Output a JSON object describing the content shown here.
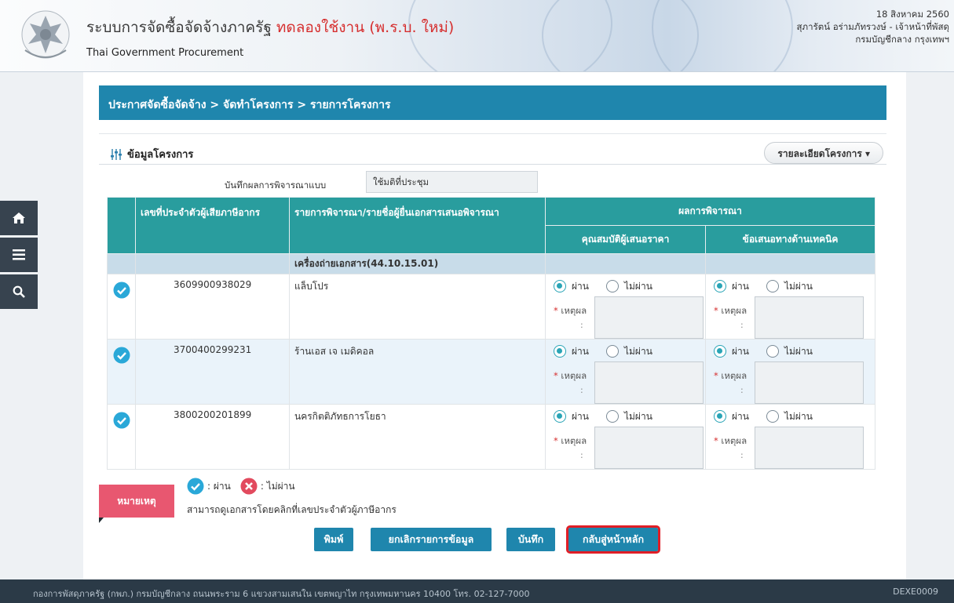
{
  "header": {
    "title_main": "ระบบการจัดซื้อจัดจ้างภาครัฐ",
    "title_trial": "ทดลองใช้งาน (พ.ร.บ. ใหม่)",
    "subtitle": "Thai Government Procurement",
    "date": "18 สิงหาคม 2560",
    "user": "สุภารัตน์ อร่ามภัทรวงษ์ - เจ้าหน้าที่พัสดุ",
    "department": "กรมบัญชีกลาง กรุงเทพฯ"
  },
  "rail": {
    "icons": [
      "home-icon",
      "menu-icon",
      "search-icon"
    ]
  },
  "breadcrumb": "ประกาศจัดซื้อจัดจ้าง > จัดทำโครงการ > รายการโครงการ",
  "section": {
    "title": "ข้อมูลโครงการ",
    "detail_button": "รายละเอียดโครงการ ▾"
  },
  "record": {
    "label": "บันทึกผลการพิจารณาแบบ",
    "value": "ใช้มติที่ประชุม"
  },
  "table": {
    "headers": {
      "tax_id": "เลขที่ประจำตัวผู้เสียภาษีอากร",
      "item": "รายการพิจารณา/รายชื่อผู้ยื่นเอกสารเสนอพิจารณา",
      "result": "ผลการพิจารณา",
      "qualification": "คุณสมบัติผู้เสนอราคา",
      "technical": "ข้อเสนอทางด้านเทคนิค"
    },
    "group": "เครื่องถ่ายเอกสาร(44.10.15.01)",
    "pass_label": "ผ่าน",
    "fail_label": "ไม่ผ่าน",
    "reason_label": "เหตุผล",
    "rows": [
      {
        "tax_id": "3609900938029",
        "name": "แล็บโปร",
        "qualification": "ผ่าน",
        "technical": "ผ่าน"
      },
      {
        "tax_id": "3700400299231",
        "name": "ร้านเอส เจ เมดิคอล",
        "qualification": "ผ่าน",
        "technical": "ผ่าน"
      },
      {
        "tax_id": "3800200201899",
        "name": "นครกิตติภัทธการโยธา",
        "qualification": "ผ่าน",
        "technical": "ผ่าน"
      }
    ]
  },
  "legend": {
    "tag": "หมายเหตุ",
    "pass": ": ผ่าน",
    "fail": ": ไม่ผ่าน",
    "text": "สามารถดูเอกสารโดยคลิกที่เลขประจำตัวผู้ภาษีอากร"
  },
  "buttons": {
    "print": "พิมพ์",
    "cancel": "ยกเลิกรายการข้อมูล",
    "save": "บันทึก",
    "back": "กลับสู่หน้าหลัก"
  },
  "footer": {
    "address": "กองการพัสดุภาครัฐ (กพภ.) กรมบัญชีกลาง ถนนพระราม 6 แขวงสามเสนใน เขตพญาไท กรุงเทพมหานคร 10400 โทร. 02-127-7000",
    "code": "DEXE0009"
  },
  "colors": {
    "accent": "#1f86ad",
    "table_header": "#299d9e",
    "pass_check": "#2aa8d8",
    "fail_x": "#e24a5e",
    "note_tag": "#e85770",
    "highlight": "#e01e26"
  }
}
